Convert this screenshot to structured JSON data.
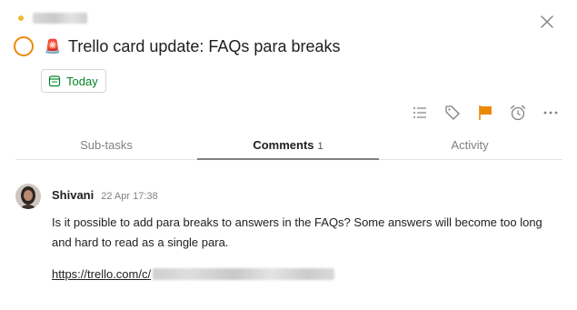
{
  "colors": {
    "project_dot": "#f2b935",
    "priority_ring": "#eb8909",
    "due_today": "#058527",
    "flag": "#eb8909",
    "icon_grey": "#808080"
  },
  "task": {
    "emoji": "🚨",
    "title": "Trello card update: FAQs para breaks",
    "due_label": "Today"
  },
  "toolbar": {
    "icons": [
      "list-icon",
      "label-icon",
      "flag-icon",
      "alarm-icon",
      "more-icon"
    ]
  },
  "tabs": [
    {
      "label": "Sub-tasks",
      "count": ""
    },
    {
      "label": "Comments",
      "count": "1"
    },
    {
      "label": "Activity",
      "count": ""
    }
  ],
  "comment": {
    "author": "Shivani",
    "timestamp": "22 Apr 17:38",
    "body": "Is it possible to add para breaks to answers in the FAQs? Some answers will become too long and hard to read as a single para.",
    "link": "https://trello.com/c/"
  }
}
